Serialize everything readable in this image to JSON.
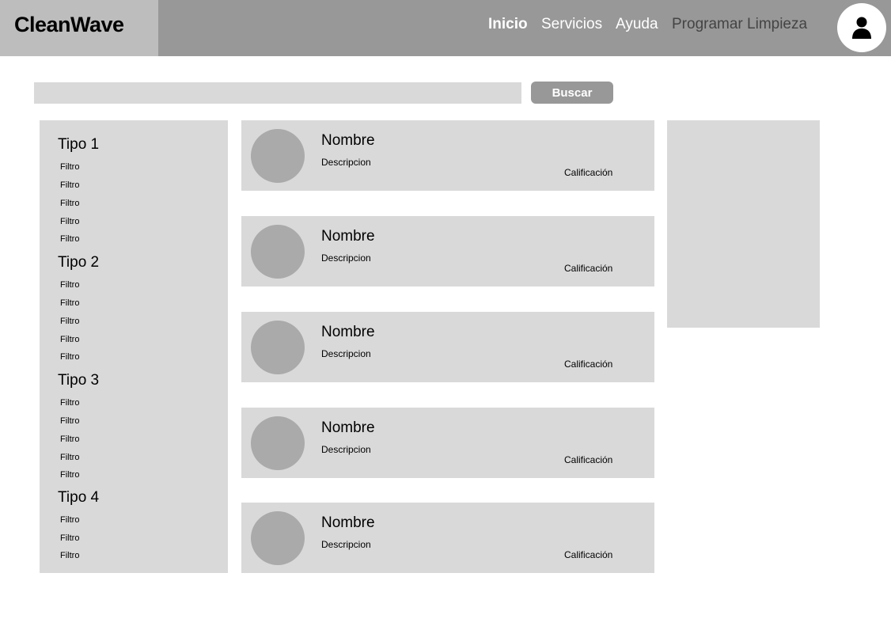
{
  "header": {
    "logo": "CleanWave",
    "nav": [
      {
        "label": "Inicio",
        "active": true
      },
      {
        "label": "Servicios",
        "active": false
      },
      {
        "label": "Ayuda",
        "active": false
      },
      {
        "label": "Programar Limpieza",
        "active": false
      }
    ],
    "avatar_icon": "user-icon"
  },
  "search": {
    "value": "",
    "placeholder": "",
    "button_label": "Buscar"
  },
  "sidebar": {
    "groups": [
      {
        "title": "Tipo 1",
        "filters": [
          "Filtro",
          "Filtro",
          "Filtro",
          "Filtro",
          "Filtro"
        ]
      },
      {
        "title": "Tipo 2",
        "filters": [
          "Filtro",
          "Filtro",
          "Filtro",
          "Filtro",
          "Filtro"
        ]
      },
      {
        "title": "Tipo 3",
        "filters": [
          "Filtro",
          "Filtro",
          "Filtro",
          "Filtro",
          "Filtro"
        ]
      },
      {
        "title": "Tipo 4",
        "filters": [
          "Filtro",
          "Filtro",
          "Filtro"
        ]
      }
    ]
  },
  "results": [
    {
      "name": "Nombre",
      "description": "Descripcion",
      "rating_label": "Calificación"
    },
    {
      "name": "Nombre",
      "description": "Descripcion",
      "rating_label": "Calificación"
    },
    {
      "name": "Nombre",
      "description": "Descripcion",
      "rating_label": "Calificación"
    },
    {
      "name": "Nombre",
      "description": "Descripcion",
      "rating_label": "Calificación"
    },
    {
      "name": "Nombre",
      "description": "Descripcion",
      "rating_label": "Calificación"
    }
  ],
  "colors": {
    "header": "#989898",
    "logo_box": "#bdbdbd",
    "panel": "#d9d9d9",
    "placeholder_circle": "#aaaaaa",
    "nav_text": "#ffffff",
    "nav_secondary": "#444444"
  }
}
